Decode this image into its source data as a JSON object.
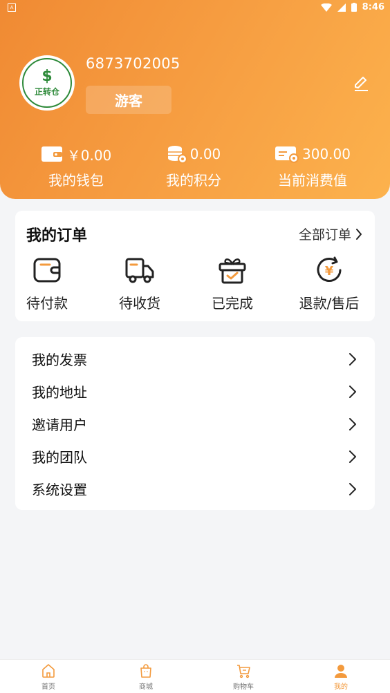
{
  "status_bar": {
    "time": "8:46"
  },
  "profile": {
    "user_id": "6873702005",
    "role": "游客",
    "avatar_text": "正转仓"
  },
  "stats": [
    {
      "value": "￥0.00",
      "label": "我的钱包",
      "icon": "wallet-icon"
    },
    {
      "value": "0.00",
      "label": "我的积分",
      "icon": "coins-icon"
    },
    {
      "value": "300.00",
      "label": "当前消费值",
      "icon": "card-icon"
    }
  ],
  "orders": {
    "title": "我的订单",
    "all_link": "全部订单",
    "items": [
      {
        "label": "待付款",
        "icon": "wallet-icon"
      },
      {
        "label": "待收货",
        "icon": "truck-icon"
      },
      {
        "label": "已完成",
        "icon": "gift-icon"
      },
      {
        "label": "退款/售后",
        "icon": "refund-icon"
      }
    ]
  },
  "menu": [
    {
      "label": "我的发票"
    },
    {
      "label": "我的地址"
    },
    {
      "label": "邀请用户"
    },
    {
      "label": "我的团队"
    },
    {
      "label": "系统设置"
    }
  ],
  "tabbar": [
    {
      "label": "首页",
      "icon": "home-icon",
      "active": false
    },
    {
      "label": "商城",
      "icon": "bag-icon",
      "active": false
    },
    {
      "label": "购物车",
      "icon": "cart-icon",
      "active": false
    },
    {
      "label": "我的",
      "icon": "user-icon",
      "active": true
    }
  ],
  "colors": {
    "accent": "#f39a3d",
    "header_start": "#f08a33",
    "header_end": "#fcb24d"
  }
}
